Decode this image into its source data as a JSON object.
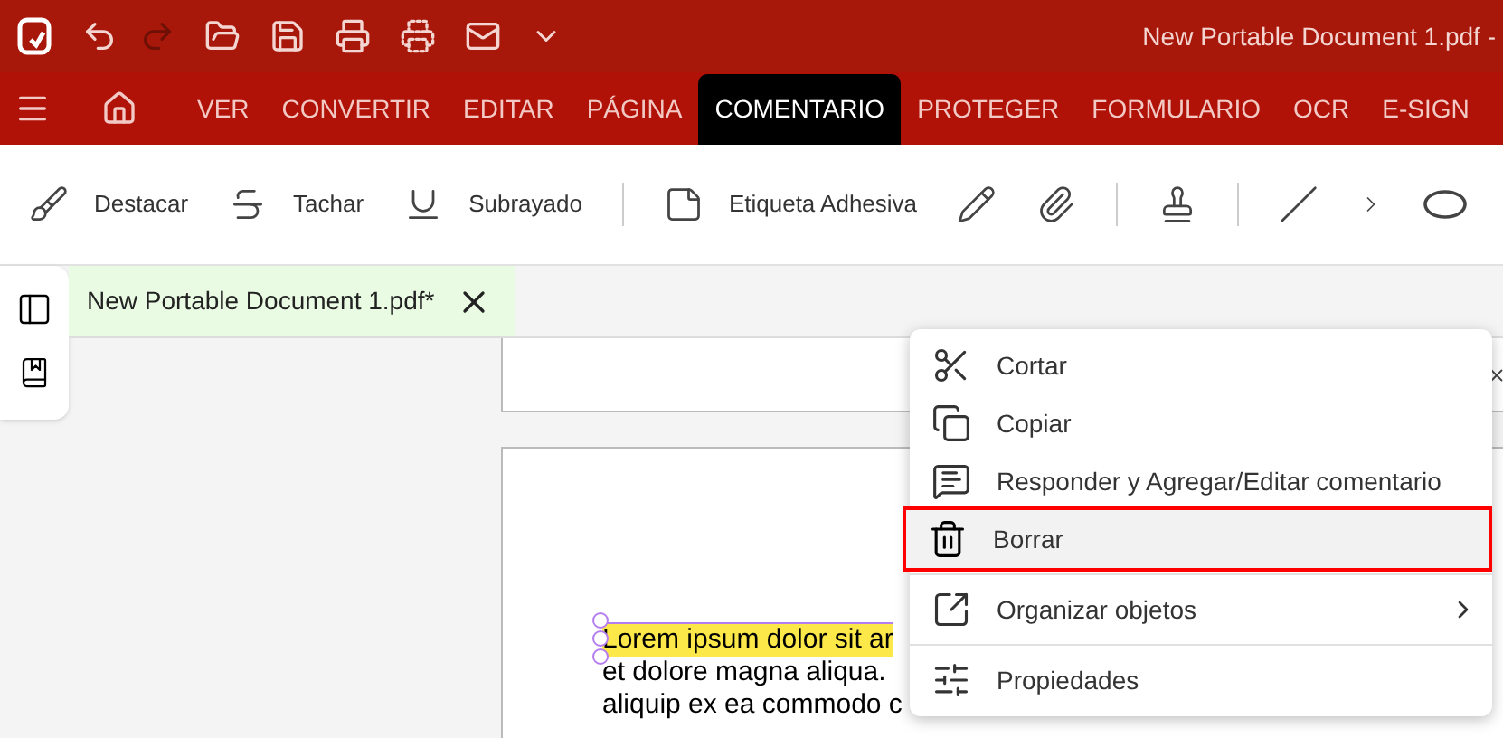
{
  "window": {
    "title": "New Portable Document 1.pdf  -"
  },
  "ribbon_tabs": [
    {
      "label": "VER",
      "selected": false
    },
    {
      "label": "CONVERTIR",
      "selected": false
    },
    {
      "label": "EDITAR",
      "selected": false
    },
    {
      "label": "PÁGINA",
      "selected": false
    },
    {
      "label": "COMENTARIO",
      "selected": true
    },
    {
      "label": "PROTEGER",
      "selected": false
    },
    {
      "label": "FORMULARIO",
      "selected": false
    },
    {
      "label": "OCR",
      "selected": false
    },
    {
      "label": "E-SIGN",
      "selected": false
    }
  ],
  "toolbar": [
    {
      "kind": "highlight",
      "label": "Destacar"
    },
    {
      "kind": "strike",
      "label": "Tachar"
    },
    {
      "kind": "underline",
      "label": "Subrayado"
    },
    {
      "kind": "divider"
    },
    {
      "kind": "note",
      "label": "Etiqueta Adhesiva"
    },
    {
      "kind": "pencil"
    },
    {
      "kind": "clip"
    },
    {
      "kind": "divider"
    },
    {
      "kind": "stamp"
    },
    {
      "kind": "divider"
    },
    {
      "kind": "line"
    },
    {
      "kind": "more"
    },
    {
      "kind": "ellipse"
    }
  ],
  "document_tab": {
    "title": "New Portable Document 1.pdf*"
  },
  "page_text": [
    {
      "text": "Lorem ipsum dolor sit ar",
      "highlighted": true
    },
    {
      "text": "et dolore magna aliqua.",
      "highlighted": false
    },
    {
      "text": "aliquip ex ea commodo c",
      "highlighted": false
    }
  ],
  "context_menu": [
    {
      "kind": "cut",
      "label": "Cortar",
      "selected": false
    },
    {
      "kind": "copy",
      "label": "Copiar",
      "selected": false
    },
    {
      "kind": "comment",
      "label": "Responder y Agregar/Editar comentario",
      "selected": false
    },
    {
      "kind": "delete",
      "label": "Borrar",
      "selected": true
    },
    {
      "kind": "arrange",
      "label": "Organizar objetos",
      "selected": false,
      "submenu": true
    },
    {
      "kind": "properties",
      "label": "Propiedades",
      "selected": false
    }
  ]
}
